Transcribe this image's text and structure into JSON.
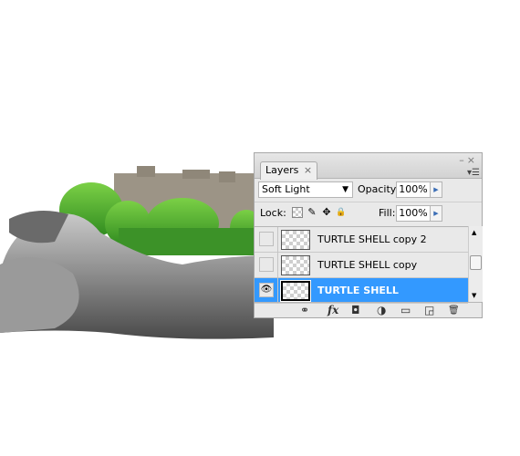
{
  "panel": {
    "tab_label": "Layers",
    "tab_close": "×",
    "window_buttons": "–×",
    "menu_icon": "▾☰",
    "blend_mode": "Soft Light",
    "opacity_label": "Opacity:",
    "opacity_value": "100%",
    "lock_label": "Lock:",
    "fill_label": "Fill:",
    "fill_value": "100%",
    "layers": [
      {
        "name": "TURTLE SHELL copy 2",
        "visible": false,
        "selected": false
      },
      {
        "name": "TURTLE SHELL copy",
        "visible": false,
        "selected": false
      },
      {
        "name": "TURTLE SHELL",
        "visible": true,
        "selected": true
      }
    ],
    "footer_icons": [
      "link-icon",
      "fx-icon",
      "mask-icon",
      "adjustment-icon",
      "folder-icon",
      "new-layer-icon",
      "trash-icon"
    ]
  },
  "glyphs": {
    "dropdown": "▼",
    "stepper": "▶",
    "eye": "👁",
    "up": "▲",
    "down": "▼",
    "brush": "✎",
    "move": "✥",
    "lock": "🔒",
    "link": "⚭",
    "fx": "fx",
    "mask": "◘",
    "adjust": "◑",
    "folder": "▭",
    "new": "◲",
    "trash": "🗑"
  }
}
